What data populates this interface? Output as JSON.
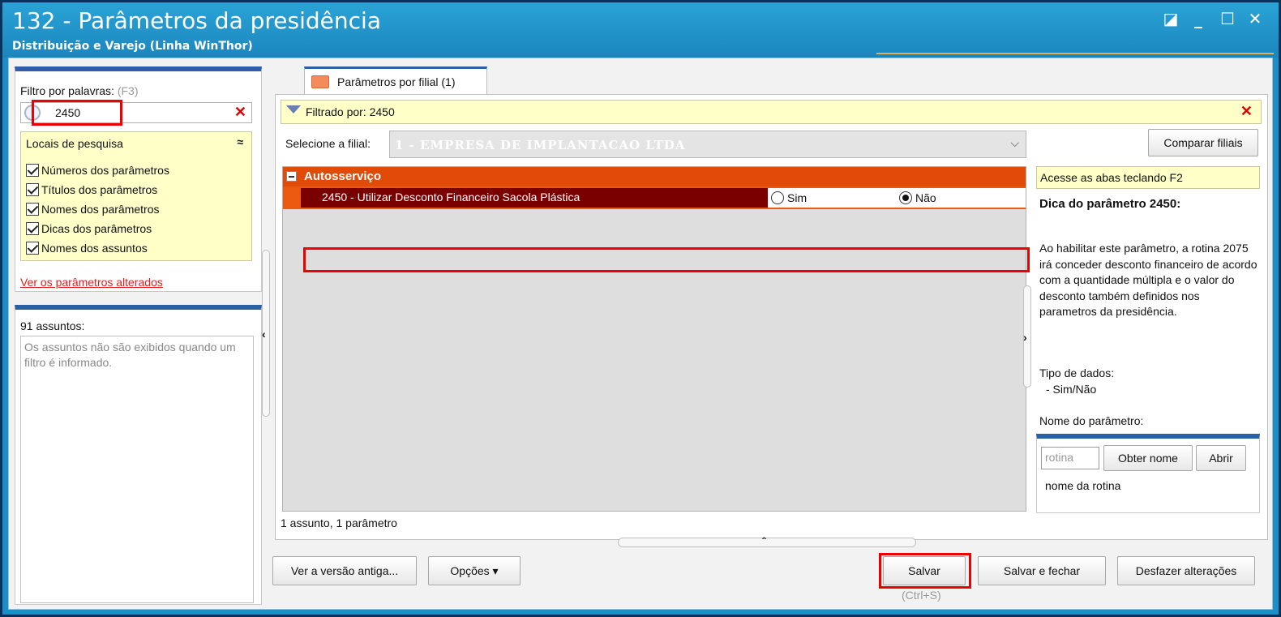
{
  "window": {
    "title": "132 - Parâmetros da presidência",
    "subtitle": "Distribuição e Varejo (Linha WinThor)",
    "controls": {
      "restore": "◪",
      "minimize": "_",
      "maximize": "☐",
      "close": "✕"
    }
  },
  "filter": {
    "label": "Filtro por palavras:",
    "shortcut": "(F3)",
    "value": "2450",
    "clear": "✕"
  },
  "search_locations": {
    "title": "Locais de pesquisa",
    "collapse": "≈",
    "items": [
      {
        "label": "Números dos parâmetros"
      },
      {
        "label": "Títulos dos parâmetros"
      },
      {
        "label": "Nomes dos parâmetros"
      },
      {
        "label": "Dicas dos parâmetros"
      },
      {
        "label": "Nomes dos assuntos"
      }
    ]
  },
  "changed_link": "Ver os parâmetros alterados",
  "subjects": {
    "label": "91 assuntos:",
    "message": "Os assuntos não são exibidos quando um filtro é informado."
  },
  "tab": {
    "label": "Parâmetros por filial  (1)"
  },
  "filtered": {
    "label": "Filtrado por: 2450",
    "clear": "✕"
  },
  "branch": {
    "label": "Selecione a filial:",
    "value": "1 - EMPRESA DE IMPLANTACAO LTDA",
    "chevron": "⌵",
    "compare_button": "Comparar filiais"
  },
  "grid": {
    "group": "Autosserviço",
    "param": {
      "label": "2450 - Utilizar Desconto Financeiro Sacola Plástica",
      "option_yes": "Sim",
      "option_no": "Não",
      "selected": "Não"
    }
  },
  "status": "1 assunto, 1 parâmetro",
  "hint": {
    "bar": "Acesse as abas teclando F2",
    "title": "Dica do parâmetro 2450:",
    "body": "Ao habilitar este parâmetro, a rotina 2075 irá conceder desconto financeiro de acordo com a quantidade múltipla e o valor do desconto também definidos nos parametros da presidência.",
    "data_type_title": "Tipo de dados:",
    "data_type_value": "- Sim/Não",
    "param_name_label": "Nome do parâmetro:",
    "rotina_placeholder": "rotina",
    "get_name_button": "Obter nome",
    "open_button": "Abrir",
    "rotina_name": "nome da rotina"
  },
  "footer": {
    "old_version": "Ver a versão antiga...",
    "options": "Opções ▾",
    "save": "Salvar",
    "save_shortcut": "(Ctrl+S)",
    "save_close": "Salvar e fechar",
    "undo": "Desfazer alterações"
  },
  "colors": {
    "titlebar": "#1b86bd",
    "group_header": "#e24a08",
    "param_row": "#7a0000",
    "highlight": "#ee0000",
    "accent_blue": "#2d5fa6",
    "hint_yellow": "#ffffc8"
  }
}
